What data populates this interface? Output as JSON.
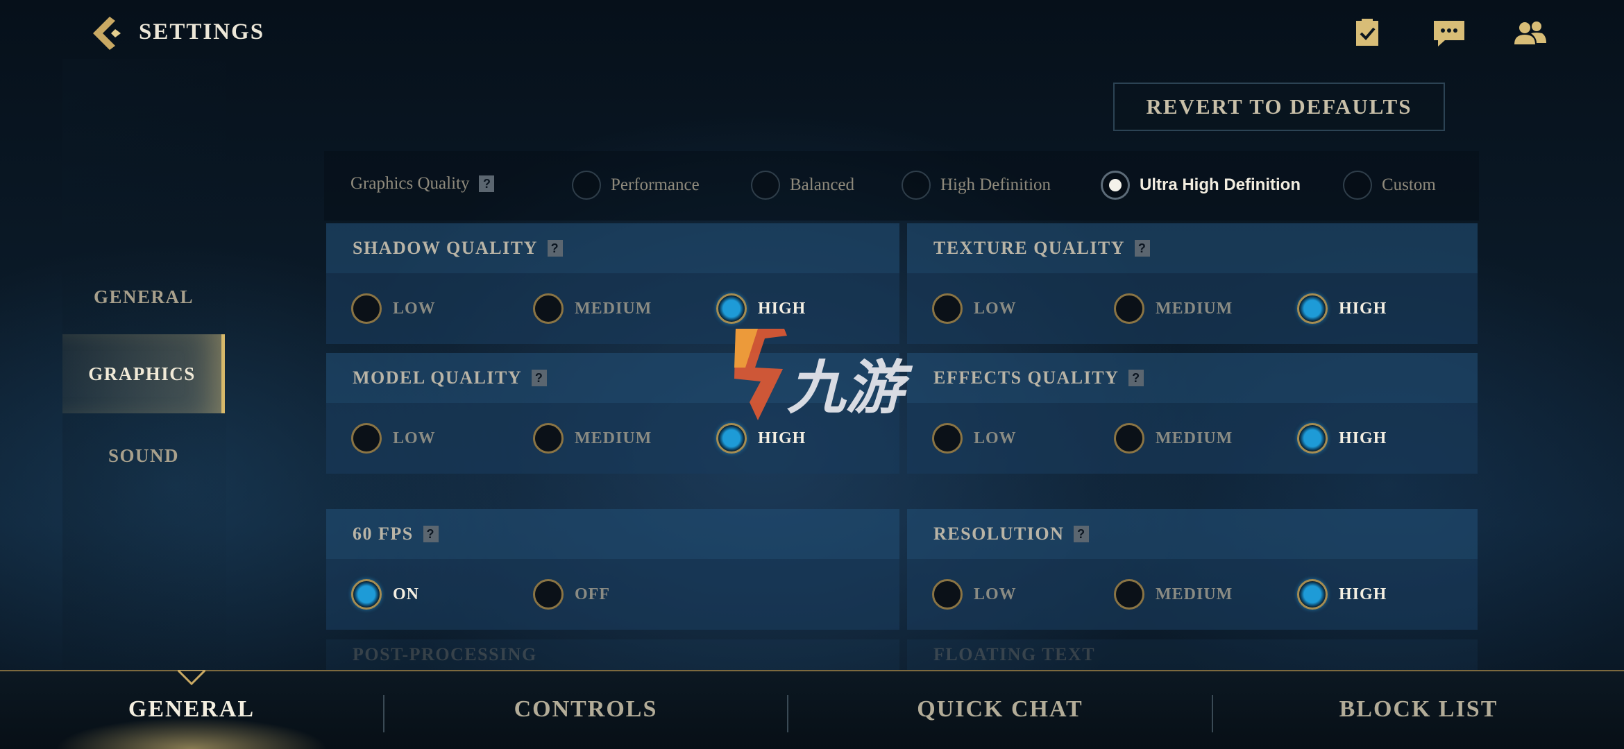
{
  "header": {
    "title": "SETTINGS",
    "icons": [
      "missions-icon",
      "chat-icon",
      "friends-icon"
    ]
  },
  "revert_label": "REVERT TO DEFAULTS",
  "sidenav": {
    "items": [
      {
        "label": "GENERAL",
        "active": false
      },
      {
        "label": "GRAPHICS",
        "active": true
      },
      {
        "label": "SOUND",
        "active": false
      }
    ]
  },
  "graphics_quality": {
    "label": "Graphics Quality",
    "help": "?",
    "options": [
      "Performance",
      "Balanced",
      "High Definition",
      "Ultra High Definition",
      "Custom"
    ],
    "selected": "Ultra High Definition"
  },
  "panels": {
    "shadow": {
      "title": "SHADOW QUALITY",
      "options": [
        "LOW",
        "MEDIUM",
        "HIGH"
      ],
      "selected": "HIGH"
    },
    "texture": {
      "title": "TEXTURE QUALITY",
      "options": [
        "LOW",
        "MEDIUM",
        "HIGH"
      ],
      "selected": "HIGH"
    },
    "model": {
      "title": "MODEL QUALITY",
      "options": [
        "LOW",
        "MEDIUM",
        "HIGH"
      ],
      "selected": "HIGH"
    },
    "effects": {
      "title": "EFFECTS QUALITY",
      "options": [
        "LOW",
        "MEDIUM",
        "HIGH"
      ],
      "selected": "HIGH"
    },
    "fps": {
      "title": "60 FPS",
      "options": [
        "ON",
        "OFF"
      ],
      "selected": "ON"
    },
    "resolution": {
      "title": "RESOLUTION",
      "options": [
        "LOW",
        "MEDIUM",
        "HIGH"
      ],
      "selected": "HIGH"
    },
    "postprocessing": {
      "title": "POST-PROCESSING"
    },
    "floating_text": {
      "title": "FLOATING TEXT"
    }
  },
  "watermark": {
    "text": "九游"
  },
  "bottom_tabs": [
    {
      "label": "GENERAL",
      "active": true
    },
    {
      "label": "CONTROLS",
      "active": false
    },
    {
      "label": "QUICK CHAT",
      "active": false
    },
    {
      "label": "BLOCK LIST",
      "active": false
    }
  ]
}
